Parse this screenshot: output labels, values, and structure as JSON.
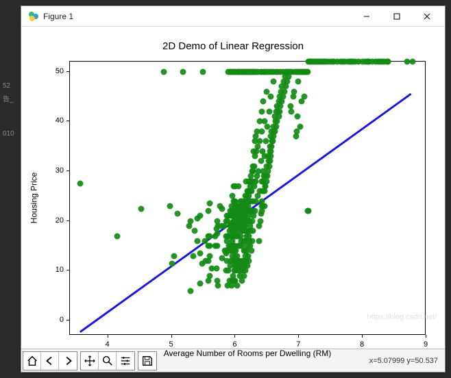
{
  "window": {
    "title": "Figure 1",
    "minimize_icon": "minimize-icon",
    "maximize_icon": "maximize-icon",
    "close_icon": "close-icon"
  },
  "bg_fragments": [
    "52",
    "告_",
    "010"
  ],
  "toolbar": {
    "icons": [
      "home-icon",
      "back-icon",
      "forward-icon",
      "pan-icon",
      "zoom-icon",
      "config-icon",
      "save-icon"
    ],
    "coords": "x=5.07999   y=50.537"
  },
  "watermark": "https://blog.csdn.net/",
  "chart_data": {
    "type": "scatter",
    "title": "2D Demo of Linear Regression",
    "xlabel": "Average Number of Rooms per Dwelling (RM)",
    "ylabel": "Housing Price",
    "xlim": [
      3.4,
      9.0
    ],
    "ylim": [
      -3,
      52
    ],
    "xticks": [
      4,
      5,
      6,
      7,
      8,
      9
    ],
    "yticks": [
      0,
      10,
      20,
      30,
      40,
      50
    ],
    "series": [
      {
        "name": "data",
        "kind": "scatter",
        "color": "#138a13",
        "x": [
          3.56,
          4.14,
          4.52,
          4.88,
          4.97,
          5.0,
          5.04,
          5.09,
          5.18,
          5.27,
          5.3,
          5.3,
          5.34,
          5.36,
          5.4,
          5.4,
          5.45,
          5.45,
          5.45,
          5.48,
          5.49,
          5.52,
          5.53,
          5.57,
          5.57,
          5.57,
          5.57,
          5.57,
          5.6,
          5.6,
          5.6,
          5.6,
          5.6,
          5.63,
          5.68,
          5.68,
          5.7,
          5.7,
          5.71,
          5.71,
          5.71,
          5.71,
          5.73,
          5.73,
          5.76,
          5.78,
          5.79,
          5.79,
          5.82,
          5.83,
          5.85,
          5.85,
          5.85,
          5.85,
          5.86,
          5.87,
          5.87,
          5.87,
          5.88,
          5.88,
          5.88,
          5.88,
          5.89,
          5.89,
          5.89,
          5.89,
          5.89,
          5.9,
          5.91,
          5.91,
          5.91,
          5.92,
          5.92,
          5.92,
          5.92,
          5.92,
          5.93,
          5.93,
          5.93,
          5.94,
          5.94,
          5.94,
          5.94,
          5.94,
          5.94,
          5.94,
          5.95,
          5.95,
          5.95,
          5.95,
          5.95,
          5.95,
          5.95,
          5.95,
          5.95,
          5.96,
          5.96,
          5.96,
          5.96,
          5.97,
          5.97,
          5.97,
          5.97,
          5.97,
          5.97,
          5.97,
          5.97,
          5.97,
          5.97,
          5.97,
          5.97,
          5.98,
          5.98,
          5.98,
          5.98,
          5.98,
          5.98,
          5.98,
          5.98,
          5.99,
          5.99,
          5.99,
          5.99,
          6.0,
          6.0,
          6.0,
          6.0,
          6.0,
          6.0,
          6.0,
          6.01,
          6.01,
          6.01,
          6.01,
          6.01,
          6.01,
          6.01,
          6.02,
          6.02,
          6.03,
          6.03,
          6.03,
          6.03,
          6.03,
          6.03,
          6.04,
          6.04,
          6.04,
          6.04,
          6.04,
          6.05,
          6.05,
          6.05,
          6.05,
          6.05,
          6.05,
          6.05,
          6.06,
          6.06,
          6.06,
          6.06,
          6.07,
          6.07,
          6.07,
          6.07,
          6.08,
          6.08,
          6.08,
          6.08,
          6.08,
          6.09,
          6.09,
          6.09,
          6.09,
          6.1,
          6.1,
          6.1,
          6.1,
          6.1,
          6.1,
          6.1,
          6.1,
          6.1,
          6.11,
          6.11,
          6.11,
          6.12,
          6.12,
          6.12,
          6.13,
          6.13,
          6.13,
          6.13,
          6.14,
          6.14,
          6.14,
          6.14,
          6.14,
          6.15,
          6.15,
          6.15,
          6.15,
          6.15,
          6.15,
          6.15,
          6.15,
          6.16,
          6.16,
          6.16,
          6.16,
          6.16,
          6.16,
          6.16,
          6.16,
          6.17,
          6.17,
          6.17,
          6.18,
          6.18,
          6.18,
          6.18,
          6.18,
          6.18,
          6.18,
          6.19,
          6.19,
          6.19,
          6.19,
          6.2,
          6.2,
          6.2,
          6.2,
          6.2,
          6.2,
          6.21,
          6.21,
          6.21,
          6.21,
          6.21,
          6.21,
          6.22,
          6.22,
          6.22,
          6.22,
          6.23,
          6.23,
          6.23,
          6.23,
          6.23,
          6.23,
          6.24,
          6.24,
          6.24,
          6.24,
          6.25,
          6.25,
          6.25,
          6.26,
          6.26,
          6.26,
          6.27,
          6.27,
          6.27,
          6.28,
          6.28,
          6.28,
          6.28,
          6.29,
          6.29,
          6.29,
          6.3,
          6.3,
          6.31,
          6.31,
          6.31,
          6.31,
          6.32,
          6.32,
          6.32,
          6.33,
          6.33,
          6.34,
          6.34,
          6.35,
          6.35,
          6.36,
          6.36,
          6.37,
          6.37,
          6.38,
          6.38,
          6.38,
          6.39,
          6.4,
          6.4,
          6.4,
          6.41,
          6.41,
          6.42,
          6.42,
          6.42,
          6.42,
          6.42,
          6.43,
          6.43,
          6.43,
          6.44,
          6.44,
          6.44,
          6.45,
          6.45,
          6.46,
          6.46,
          6.46,
          6.46,
          6.46,
          6.47,
          6.47,
          6.48,
          6.48,
          6.49,
          6.49,
          6.49,
          6.49,
          6.5,
          6.5,
          6.51,
          6.51,
          6.52,
          6.52,
          6.53,
          6.53,
          6.54,
          6.54,
          6.54,
          6.55,
          6.55,
          6.55,
          6.56,
          6.56,
          6.57,
          6.57,
          6.58,
          6.59,
          6.59,
          6.6,
          6.6,
          6.6,
          6.61,
          6.62,
          6.62,
          6.63,
          6.63,
          6.64,
          6.64,
          6.65,
          6.65,
          6.66,
          6.67,
          6.68,
          6.68,
          6.69,
          6.7,
          6.71,
          6.71,
          6.72,
          6.73,
          6.73,
          6.75,
          6.75,
          6.76,
          6.77,
          6.78,
          6.79,
          6.79,
          6.8,
          6.81,
          6.82,
          6.83,
          6.84,
          6.85,
          6.86,
          6.87,
          6.87,
          6.88,
          6.9,
          6.91,
          6.92,
          6.94,
          6.95,
          6.96,
          6.97,
          6.97,
          6.98,
          6.99,
          7.0,
          7.01,
          7.02,
          7.04,
          7.04,
          7.05,
          7.07,
          7.08,
          7.1,
          7.1,
          7.12,
          7.14,
          7.14,
          7.15,
          7.15,
          7.16,
          7.17,
          7.18,
          7.19,
          7.21,
          7.23,
          7.25,
          7.27,
          7.29,
          7.31,
          7.33,
          7.35,
          7.37,
          7.4,
          7.42,
          7.45,
          7.49,
          7.52,
          7.55,
          7.6,
          7.65,
          7.69,
          7.72,
          7.77,
          7.8,
          7.83,
          7.85,
          7.88,
          7.93,
          8.0,
          8.04,
          8.07,
          8.09,
          8.1,
          8.15,
          8.2,
          8.25,
          8.27,
          8.3,
          8.33,
          8.37,
          8.4,
          8.4,
          8.7,
          8.78
        ],
        "y": [
          27.5,
          17.0,
          22.5,
          50,
          23,
          11.5,
          13,
          21.5,
          50,
          19,
          6,
          20,
          13,
          18,
          16,
          20.5,
          7.5,
          13.5,
          21,
          11.5,
          50,
          16,
          12,
          8,
          12,
          15,
          17,
          22,
          9,
          13,
          15,
          17,
          23.5,
          10.5,
          15,
          17,
          10.5,
          18.5,
          8,
          15,
          17.5,
          20,
          7,
          19,
          23,
          19,
          12.5,
          22.5,
          19,
          14,
          10,
          13.5,
          17,
          20,
          14,
          12,
          16,
          21,
          7,
          14,
          17,
          20,
          10,
          14,
          17,
          21,
          50,
          15,
          8,
          14,
          18,
          11,
          15,
          19,
          22,
          50,
          12,
          17,
          21,
          7,
          14,
          17,
          19,
          21,
          23,
          50,
          8,
          13,
          16,
          18,
          19.5,
          21,
          22,
          50,
          25,
          9,
          14,
          17,
          21,
          8,
          12,
          15,
          18,
          20,
          22,
          24,
          27,
          50,
          12,
          14,
          21,
          10,
          14,
          17,
          19,
          21,
          24,
          50,
          21,
          11,
          15,
          19,
          23,
          8,
          13,
          17,
          20,
          22,
          24,
          27,
          10,
          14,
          18,
          20,
          22,
          50,
          21,
          11,
          20,
          7,
          13,
          17,
          19,
          21,
          23,
          12,
          17,
          20,
          22,
          50,
          10,
          15,
          19,
          21,
          23,
          27,
          50,
          12,
          18,
          21,
          50,
          9,
          15,
          20,
          23,
          11,
          17,
          21,
          24,
          50,
          10,
          16,
          20,
          23,
          12,
          19,
          22,
          8,
          15,
          21,
          24,
          50,
          21,
          11,
          18,
          23,
          10,
          18,
          22,
          50,
          14,
          20,
          24,
          9,
          16,
          21,
          50,
          12,
          19,
          23,
          11,
          19,
          23,
          50,
          14,
          21,
          25,
          10,
          18,
          23,
          13,
          20,
          50,
          16,
          22,
          28,
          12,
          20,
          25,
          14,
          22,
          50,
          17,
          24,
          11,
          20,
          26,
          15,
          23,
          50,
          18,
          26,
          13,
          22,
          50,
          17,
          25,
          12,
          21,
          28,
          16,
          24,
          50,
          20,
          28,
          15,
          24,
          19,
          27,
          22,
          50,
          26,
          18,
          29,
          14,
          26,
          50,
          20,
          30,
          16,
          28,
          22,
          31,
          50,
          18,
          30,
          24,
          34,
          50,
          21,
          31,
          27,
          36,
          22,
          33,
          50,
          28,
          37,
          24,
          34,
          50,
          29,
          38,
          25,
          35,
          50,
          30,
          19,
          16,
          40,
          26,
          36,
          20,
          21.5,
          50,
          32,
          22,
          42,
          28,
          23,
          38,
          24,
          50,
          23,
          34,
          26,
          28,
          44,
          30,
          29,
          50,
          26,
          40,
          23,
          33,
          50,
          27,
          27,
          36,
          29,
          46,
          28,
          31,
          50,
          39,
          29,
          33,
          30,
          50,
          32,
          31,
          42,
          32,
          35,
          34,
          50,
          33,
          45,
          34,
          37,
          35,
          38,
          36,
          50,
          36,
          39,
          37,
          48,
          38,
          41,
          38,
          50,
          40,
          42,
          39,
          43,
          40,
          50,
          42,
          44,
          41,
          45,
          42,
          50,
          43,
          46,
          44,
          47,
          50,
          45,
          48,
          46,
          49,
          50,
          47,
          50,
          48,
          50,
          49,
          50,
          50,
          50,
          43,
          50,
          42,
          50,
          45,
          46,
          50,
          37,
          38,
          50,
          50,
          41,
          48,
          50,
          50,
          39,
          50,
          44,
          50,
          50,
          45,
          50,
          50,
          50,
          50,
          22,
          22
        ]
      },
      {
        "name": "regression",
        "kind": "line",
        "color": "#1818d8",
        "x": [
          3.56,
          8.78
        ],
        "y": [
          -2.5,
          45.5
        ]
      }
    ]
  }
}
